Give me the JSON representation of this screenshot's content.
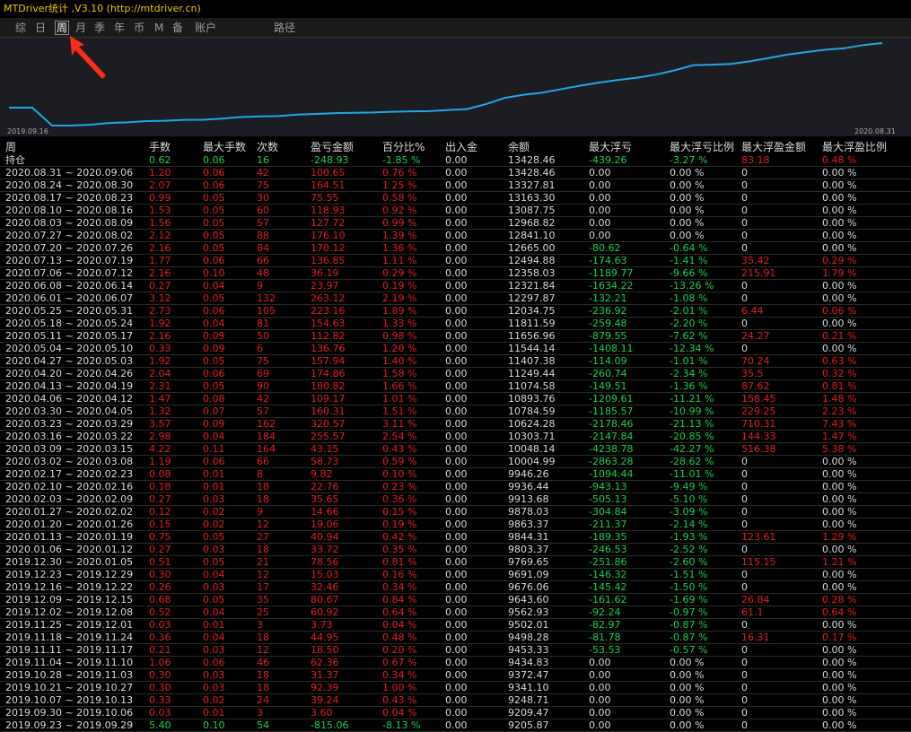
{
  "title": "MTDriver统计 ,V3.10 (http://mtdriver.cn)",
  "toolbar": {
    "tabs": [
      "综",
      "日",
      "周",
      "月",
      "季",
      "年",
      "币",
      "M",
      "备",
      "账户"
    ],
    "active": "周",
    "extra": "路径"
  },
  "chart": {
    "start_date": "2019.09.16",
    "end_date": "2020.08.31",
    "line_color": "#1fa8e0",
    "series": [
      9205.87,
      9209.47,
      9248.71,
      9341.1,
      9372.47,
      9434.83,
      9453.33,
      9498.28,
      9502.01,
      9562.93,
      9643.6,
      9676.06,
      9691.09,
      9769.65,
      9803.37,
      9844.31,
      9863.37,
      9878.03,
      9913.68,
      9936.44,
      9946.26,
      10004.99,
      10048.14,
      10303.71,
      10624.28,
      10784.59,
      10893.76,
      11074.58,
      11249.44,
      11407.38,
      11544.14,
      11656.96,
      11811.59,
      12034.75,
      12297.87,
      12321.84,
      12358.03,
      12494.88,
      12665.0,
      12841.1,
      12968.82,
      13087.75,
      13163.3,
      13327.81,
      13428.46
    ]
  },
  "columns": [
    "周",
    "手数",
    "最大手数",
    "次数",
    "盈亏金额",
    "百分比%",
    "出入金",
    "余额",
    "最大浮亏",
    "最大浮亏比例",
    "最大浮盈金额",
    "最大浮盈比例"
  ],
  "holding": [
    "持仓",
    "0.62",
    "0.06",
    "16",
    "-248.93",
    "-1.85 %",
    "0.00",
    "13428.46",
    "-439.26",
    "-3.27 %",
    "83.18",
    "0.48 %"
  ],
  "holding_colors": [
    "w",
    "g",
    "g",
    "g",
    "g",
    "g",
    "w",
    "w",
    "g",
    "g",
    "r",
    "r"
  ],
  "rows": [
    [
      "2020.08.31 ~ 2020.09.06",
      "1.20",
      "0.06",
      "42",
      "100.65",
      "0.76 %",
      "0.00",
      "13428.46",
      "0.00",
      "0.00 %",
      "0",
      "0.00 %"
    ],
    [
      "2020.08.24 ~ 2020.08.30",
      "2.07",
      "0.06",
      "75",
      "164.51",
      "1.25 %",
      "0.00",
      "13327.81",
      "0.00",
      "0.00 %",
      "0",
      "0.00 %"
    ],
    [
      "2020.08.17 ~ 2020.08.23",
      "0.99",
      "0.05",
      "30",
      "75.55",
      "0.58 %",
      "0.00",
      "13163.30",
      "0.00",
      "0.00 %",
      "0",
      "0.00 %"
    ],
    [
      "2020.08.10 ~ 2020.08.16",
      "1.53",
      "0.05",
      "60",
      "118.93",
      "0.92 %",
      "0.00",
      "13087.75",
      "0.00",
      "0.00 %",
      "0",
      "0.00 %"
    ],
    [
      "2020.08.03 ~ 2020.08.09",
      "1.56",
      "0.05",
      "57",
      "127.72",
      "0.99 %",
      "0.00",
      "12968.82",
      "0.00",
      "0.00 %",
      "0",
      "0.00 %"
    ],
    [
      "2020.07.27 ~ 2020.08.02",
      "2.12",
      "0.05",
      "88",
      "176.10",
      "1.39 %",
      "0.00",
      "12841.10",
      "0.00",
      "0.00 %",
      "0",
      "0.00 %"
    ],
    [
      "2020.07.20 ~ 2020.07.26",
      "2.16",
      "0.05",
      "84",
      "170.12",
      "1.36 %",
      "0.00",
      "12665.00",
      "-80.62",
      "-0.64 %",
      "0",
      "0.00 %"
    ],
    [
      "2020.07.13 ~ 2020.07.19",
      "1.77",
      "0.06",
      "66",
      "136.85",
      "1.11 %",
      "0.00",
      "12494.88",
      "-174.63",
      "-1.41 %",
      "35.42",
      "0.29 %"
    ],
    [
      "2020.07.06 ~ 2020.07.12",
      "2.16",
      "0.10",
      "48",
      "36.19",
      "0.29 %",
      "0.00",
      "12358.03",
      "-1189.77",
      "-9.66 %",
      "215.91",
      "1.79 %"
    ],
    [
      "2020.06.08 ~ 2020.06.14",
      "0.27",
      "0.04",
      "9",
      "23.97",
      "0.19 %",
      "0.00",
      "12321.84",
      "-1634.22",
      "-13.26 %",
      "0",
      "0.00 %"
    ],
    [
      "2020.06.01 ~ 2020.06.07",
      "3.12",
      "0.05",
      "132",
      "263.12",
      "2.19 %",
      "0.00",
      "12297.87",
      "-132.21",
      "-1.08 %",
      "0",
      "0.00 %"
    ],
    [
      "2020.05.25 ~ 2020.05.31",
      "2.73",
      "0.06",
      "105",
      "223.16",
      "1.89 %",
      "0.00",
      "12034.75",
      "-236.92",
      "-2.01 %",
      "6.44",
      "0.06 %"
    ],
    [
      "2020.05.18 ~ 2020.05.24",
      "1.92",
      "0.04",
      "81",
      "154.63",
      "1.33 %",
      "0.00",
      "11811.59",
      "-259.48",
      "-2.20 %",
      "0",
      "0.00 %"
    ],
    [
      "2020.05.11 ~ 2020.05.17",
      "2.16",
      "0.09",
      "50",
      "112.82",
      "0.98 %",
      "0.00",
      "11656.96",
      "-879.55",
      "-7.62 %",
      "24.27",
      "0.21 %"
    ],
    [
      "2020.05.04 ~ 2020.05.10",
      "0.33",
      "0.09",
      "6",
      "136.76",
      "1.20 %",
      "0.00",
      "11544.14",
      "-1408.11",
      "-12.34 %",
      "0",
      "0.00 %"
    ],
    [
      "2020.04.27 ~ 2020.05.03",
      "1.92",
      "0.05",
      "75",
      "157.94",
      "1.40 %",
      "0.00",
      "11407.38",
      "-114.09",
      "-1.01 %",
      "70.24",
      "0.63 %"
    ],
    [
      "2020.04.20 ~ 2020.04.26",
      "2.04",
      "0.06",
      "69",
      "174.86",
      "1.58 %",
      "0.00",
      "11249.44",
      "-260.74",
      "-2.34 %",
      "35.5",
      "0.32 %"
    ],
    [
      "2020.04.13 ~ 2020.04.19",
      "2.31",
      "0.05",
      "90",
      "180.82",
      "1.66 %",
      "0.00",
      "11074.58",
      "-149.51",
      "-1.36 %",
      "87.62",
      "0.81 %"
    ],
    [
      "2020.04.06 ~ 2020.04.12",
      "1.47",
      "0.08",
      "42",
      "109.17",
      "1.01 %",
      "0.00",
      "10893.76",
      "-1209.61",
      "-11.21 %",
      "158.45",
      "1.48 %"
    ],
    [
      "2020.03.30 ~ 2020.04.05",
      "1.32",
      "0.07",
      "57",
      "160.31",
      "1.51 %",
      "0.00",
      "10784.59",
      "-1185.57",
      "-10.99 %",
      "229.25",
      "2.23 %"
    ],
    [
      "2020.03.23 ~ 2020.03.29",
      "3.57",
      "0.09",
      "162",
      "320.57",
      "3.11 %",
      "0.00",
      "10624.28",
      "-2178.46",
      "-21.13 %",
      "710.31",
      "7.43 %"
    ],
    [
      "2020.03.16 ~ 2020.03.22",
      "2.98",
      "0.04",
      "184",
      "255.57",
      "2.54 %",
      "0.00",
      "10303.71",
      "-2147.84",
      "-20.85 %",
      "144.33",
      "1.47 %"
    ],
    [
      "2020.03.09 ~ 2020.03.15",
      "4.22",
      "0.11",
      "164",
      "43.15",
      "0.43 %",
      "0.00",
      "10048.14",
      "-4238.78",
      "-42.27 %",
      "516.38",
      "5.38 %"
    ],
    [
      "2020.03.02 ~ 2020.03.08",
      "1.19",
      "0.06",
      "66",
      "58.73",
      "0.59 %",
      "0.00",
      "10004.99",
      "-2863.28",
      "-28.62 %",
      "0",
      "0.00 %"
    ],
    [
      "2020.02.17 ~ 2020.02.23",
      "0.08",
      "0.01",
      "8",
      "9.82",
      "0.10 %",
      "0.00",
      "9946.26",
      "-1094.44",
      "-11.01 %",
      "0",
      "0.00 %"
    ],
    [
      "2020.02.10 ~ 2020.02.16",
      "0.18",
      "0.01",
      "18",
      "22.76",
      "0.23 %",
      "0.00",
      "9936.44",
      "-943.13",
      "-9.49 %",
      "0",
      "0.00 %"
    ],
    [
      "2020.02.03 ~ 2020.02.09",
      "0.27",
      "0.03",
      "18",
      "35.65",
      "0.36 %",
      "0.00",
      "9913.68",
      "-505.13",
      "-5.10 %",
      "0",
      "0.00 %"
    ],
    [
      "2020.01.27 ~ 2020.02.02",
      "0.12",
      "0.02",
      "9",
      "14.66",
      "0.15 %",
      "0.00",
      "9878.03",
      "-304.84",
      "-3.09 %",
      "0",
      "0.00 %"
    ],
    [
      "2020.01.20 ~ 2020.01.26",
      "0.15",
      "0.02",
      "12",
      "19.06",
      "0.19 %",
      "0.00",
      "9863.37",
      "-211.37",
      "-2.14 %",
      "0",
      "0.00 %"
    ],
    [
      "2020.01.13 ~ 2020.01.19",
      "0.75",
      "0.05",
      "27",
      "40.94",
      "0.42 %",
      "0.00",
      "9844.31",
      "-189.35",
      "-1.93 %",
      "123.61",
      "1.29 %"
    ],
    [
      "2020.01.06 ~ 2020.01.12",
      "0.27",
      "0.03",
      "18",
      "33.72",
      "0.35 %",
      "0.00",
      "9803.37",
      "-246.53",
      "-2.52 %",
      "0",
      "0.00 %"
    ],
    [
      "2019.12.30 ~ 2020.01.05",
      "0.51",
      "0.05",
      "21",
      "78.56",
      "0.81 %",
      "0.00",
      "9769.65",
      "-251.86",
      "-2.60 %",
      "115.15",
      "1.21 %"
    ],
    [
      "2019.12.23 ~ 2019.12.29",
      "0.30",
      "0.04",
      "12",
      "15.03",
      "0.16 %",
      "0.00",
      "9691.09",
      "-146.32",
      "-1.51 %",
      "0",
      "0.00 %"
    ],
    [
      "2019.12.16 ~ 2019.12.22",
      "0.26",
      "0.03",
      "17",
      "32.46",
      "0.34 %",
      "0.00",
      "9676.06",
      "-145.42",
      "-1.50 %",
      "0",
      "0.00 %"
    ],
    [
      "2019.12.09 ~ 2019.12.15",
      "0.68",
      "0.05",
      "35",
      "80.67",
      "0.84 %",
      "0.00",
      "9643.60",
      "-161.62",
      "-1.69 %",
      "26.84",
      "0.28 %"
    ],
    [
      "2019.12.02 ~ 2019.12.08",
      "0.52",
      "0.04",
      "25",
      "60.92",
      "0.64 %",
      "0.00",
      "9562.93",
      "-92.24",
      "-0.97 %",
      "61.1",
      "0.64 %"
    ],
    [
      "2019.11.25 ~ 2019.12.01",
      "0.03",
      "0.01",
      "3",
      "3.73",
      "0.04 %",
      "0.00",
      "9502.01",
      "-82.97",
      "-0.87 %",
      "0",
      "0.00 %"
    ],
    [
      "2019.11.18 ~ 2019.11.24",
      "0.36",
      "0.04",
      "18",
      "44.95",
      "0.48 %",
      "0.00",
      "9498.28",
      "-81.78",
      "-0.87 %",
      "16.31",
      "0.17 %"
    ],
    [
      "2019.11.11 ~ 2019.11.17",
      "0.21",
      "0.03",
      "12",
      "18.50",
      "0.20 %",
      "0.00",
      "9453.33",
      "-53.53",
      "-0.57 %",
      "0",
      "0.00 %"
    ],
    [
      "2019.11.04 ~ 2019.11.10",
      "1.06",
      "0.06",
      "46",
      "62.36",
      "0.67 %",
      "0.00",
      "9434.83",
      "0.00",
      "0.00 %",
      "0",
      "0.00 %"
    ],
    [
      "2019.10.28 ~ 2019.11.03",
      "0.30",
      "0.03",
      "18",
      "31.37",
      "0.34 %",
      "0.00",
      "9372.47",
      "0.00",
      "0.00 %",
      "0",
      "0.00 %"
    ],
    [
      "2019.10.21 ~ 2019.10.27",
      "0.30",
      "0.03",
      "18",
      "92.39",
      "1.00 %",
      "0.00",
      "9341.10",
      "0.00",
      "0.00 %",
      "0",
      "0.00 %"
    ],
    [
      "2019.10.07 ~ 2019.10.13",
      "0.33",
      "0.02",
      "24",
      "39.24",
      "0.43 %",
      "0.00",
      "9248.71",
      "0.00",
      "0.00 %",
      "0",
      "0.00 %"
    ],
    [
      "2019.09.30 ~ 2019.10.06",
      "0.03",
      "0.01",
      "3",
      "3.60",
      "0.04 %",
      "0.00",
      "9209.47",
      "0.00",
      "0.00 %",
      "0",
      "0.00 %"
    ],
    [
      "2019.09.23 ~ 2019.09.29",
      "5.40",
      "0.10",
      "54",
      "-815.06",
      "-8.13 %",
      "0.00",
      "9205.87",
      "0.00",
      "0.00 %",
      "0",
      "0.00 %"
    ]
  ]
}
